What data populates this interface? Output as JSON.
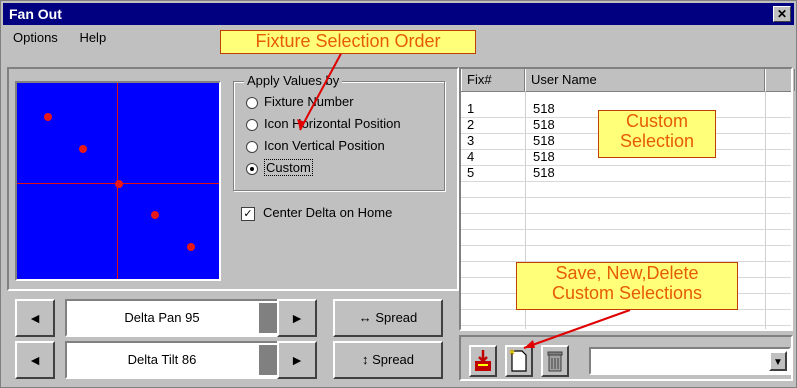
{
  "window": {
    "title": "Fan Out",
    "close_label": "✕"
  },
  "menu": [
    {
      "label": "Options"
    },
    {
      "label": "Help"
    }
  ],
  "apply_values": {
    "legend": "Apply Values by",
    "options": [
      {
        "label": "Fixture Number",
        "selected": false
      },
      {
        "label": "Icon Horizontal Position",
        "selected": false
      },
      {
        "label": "Icon Vertical Position",
        "selected": false
      },
      {
        "label": "Custom",
        "selected": true
      }
    ]
  },
  "center_delta": {
    "label": "Center Delta on  Home",
    "checked": true,
    "mark": "✓"
  },
  "pan": {
    "left_arrow": "◄",
    "label": "Delta Pan 95",
    "value": 95,
    "right_arrow": "►",
    "spread_icon": "↔",
    "spread_label": "Spread"
  },
  "tilt": {
    "left_arrow": "◄",
    "label": "Delta Tilt 86",
    "value": 86,
    "right_arrow": "►",
    "spread_icon": "↕",
    "spread_label": "Spread"
  },
  "grid": {
    "columns": [
      "Fix#",
      "User Name",
      ""
    ],
    "rows": [
      {
        "fix": "1",
        "name": "518"
      },
      {
        "fix": "2",
        "name": "518"
      },
      {
        "fix": "3",
        "name": "518"
      },
      {
        "fix": "4",
        "name": "518"
      },
      {
        "fix": "5",
        "name": "518"
      }
    ]
  },
  "toolbar": {
    "save_icon": "save-icon",
    "new_icon": "new-icon",
    "delete_icon": "delete-icon",
    "combo_value": "",
    "dropdown_arrow": "▼"
  },
  "callouts": {
    "fixture_order": "Fixture Selection Order",
    "custom_selection_line1": "Custom",
    "custom_selection_line2": "Selection",
    "save_line1": "Save, New,Delete",
    "save_line2": "Custom Selections"
  },
  "colors": {
    "title_bar": "#000080",
    "plot_bg": "#0000ff",
    "plot_marks": "#e81818",
    "callout_bg": "#ffff7a",
    "callout_text": "#e65c00"
  }
}
